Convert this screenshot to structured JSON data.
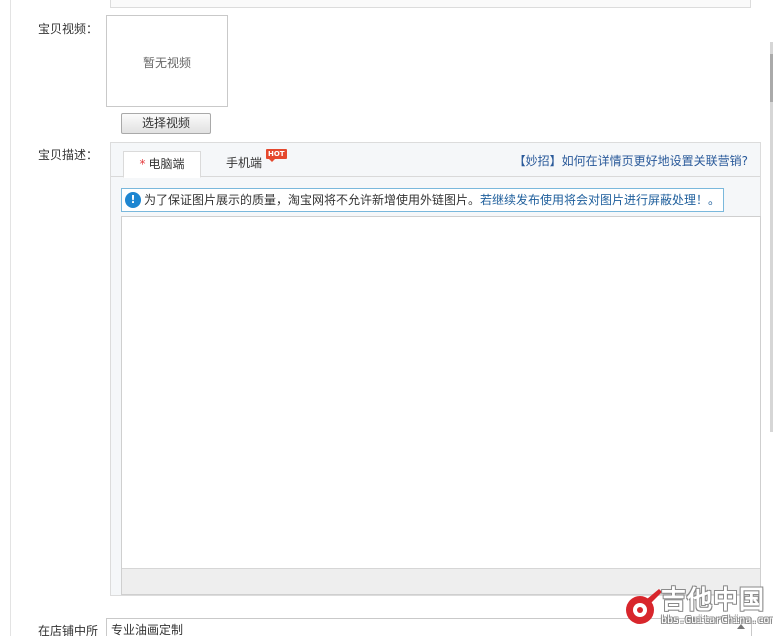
{
  "video": {
    "label": "宝贝视频：",
    "placeholder": "暂无视频",
    "select_button": "选择视频"
  },
  "description": {
    "label": "宝贝描述：",
    "tabs": [
      {
        "label": "电脑端",
        "required_mark": "*",
        "active": true
      },
      {
        "label": "手机端",
        "badge": "HOT",
        "active": false
      }
    ],
    "tip_link": "【妙招】如何在详情页更好地设置关联营销?",
    "notice": {
      "icon": "info-icon",
      "text": "为了保证图片展示的质量，淘宝网将不允许新增使用外链图片。",
      "warning": "若继续发布使用将会对图片进行屏蔽处理！。"
    }
  },
  "shop_category": {
    "label": "在店铺中所",
    "value": "专业油画定制"
  },
  "watermark": {
    "title": "吉他中国",
    "url": "bbs.GuitarChina.com",
    "logo": "guitarchina-logo"
  },
  "colors": {
    "link": "#2a5a9a",
    "required": "#e4393c",
    "hot_badge": "#e5482d",
    "info_icon": "#1e86d1",
    "notice_border": "#7ab8dc"
  }
}
